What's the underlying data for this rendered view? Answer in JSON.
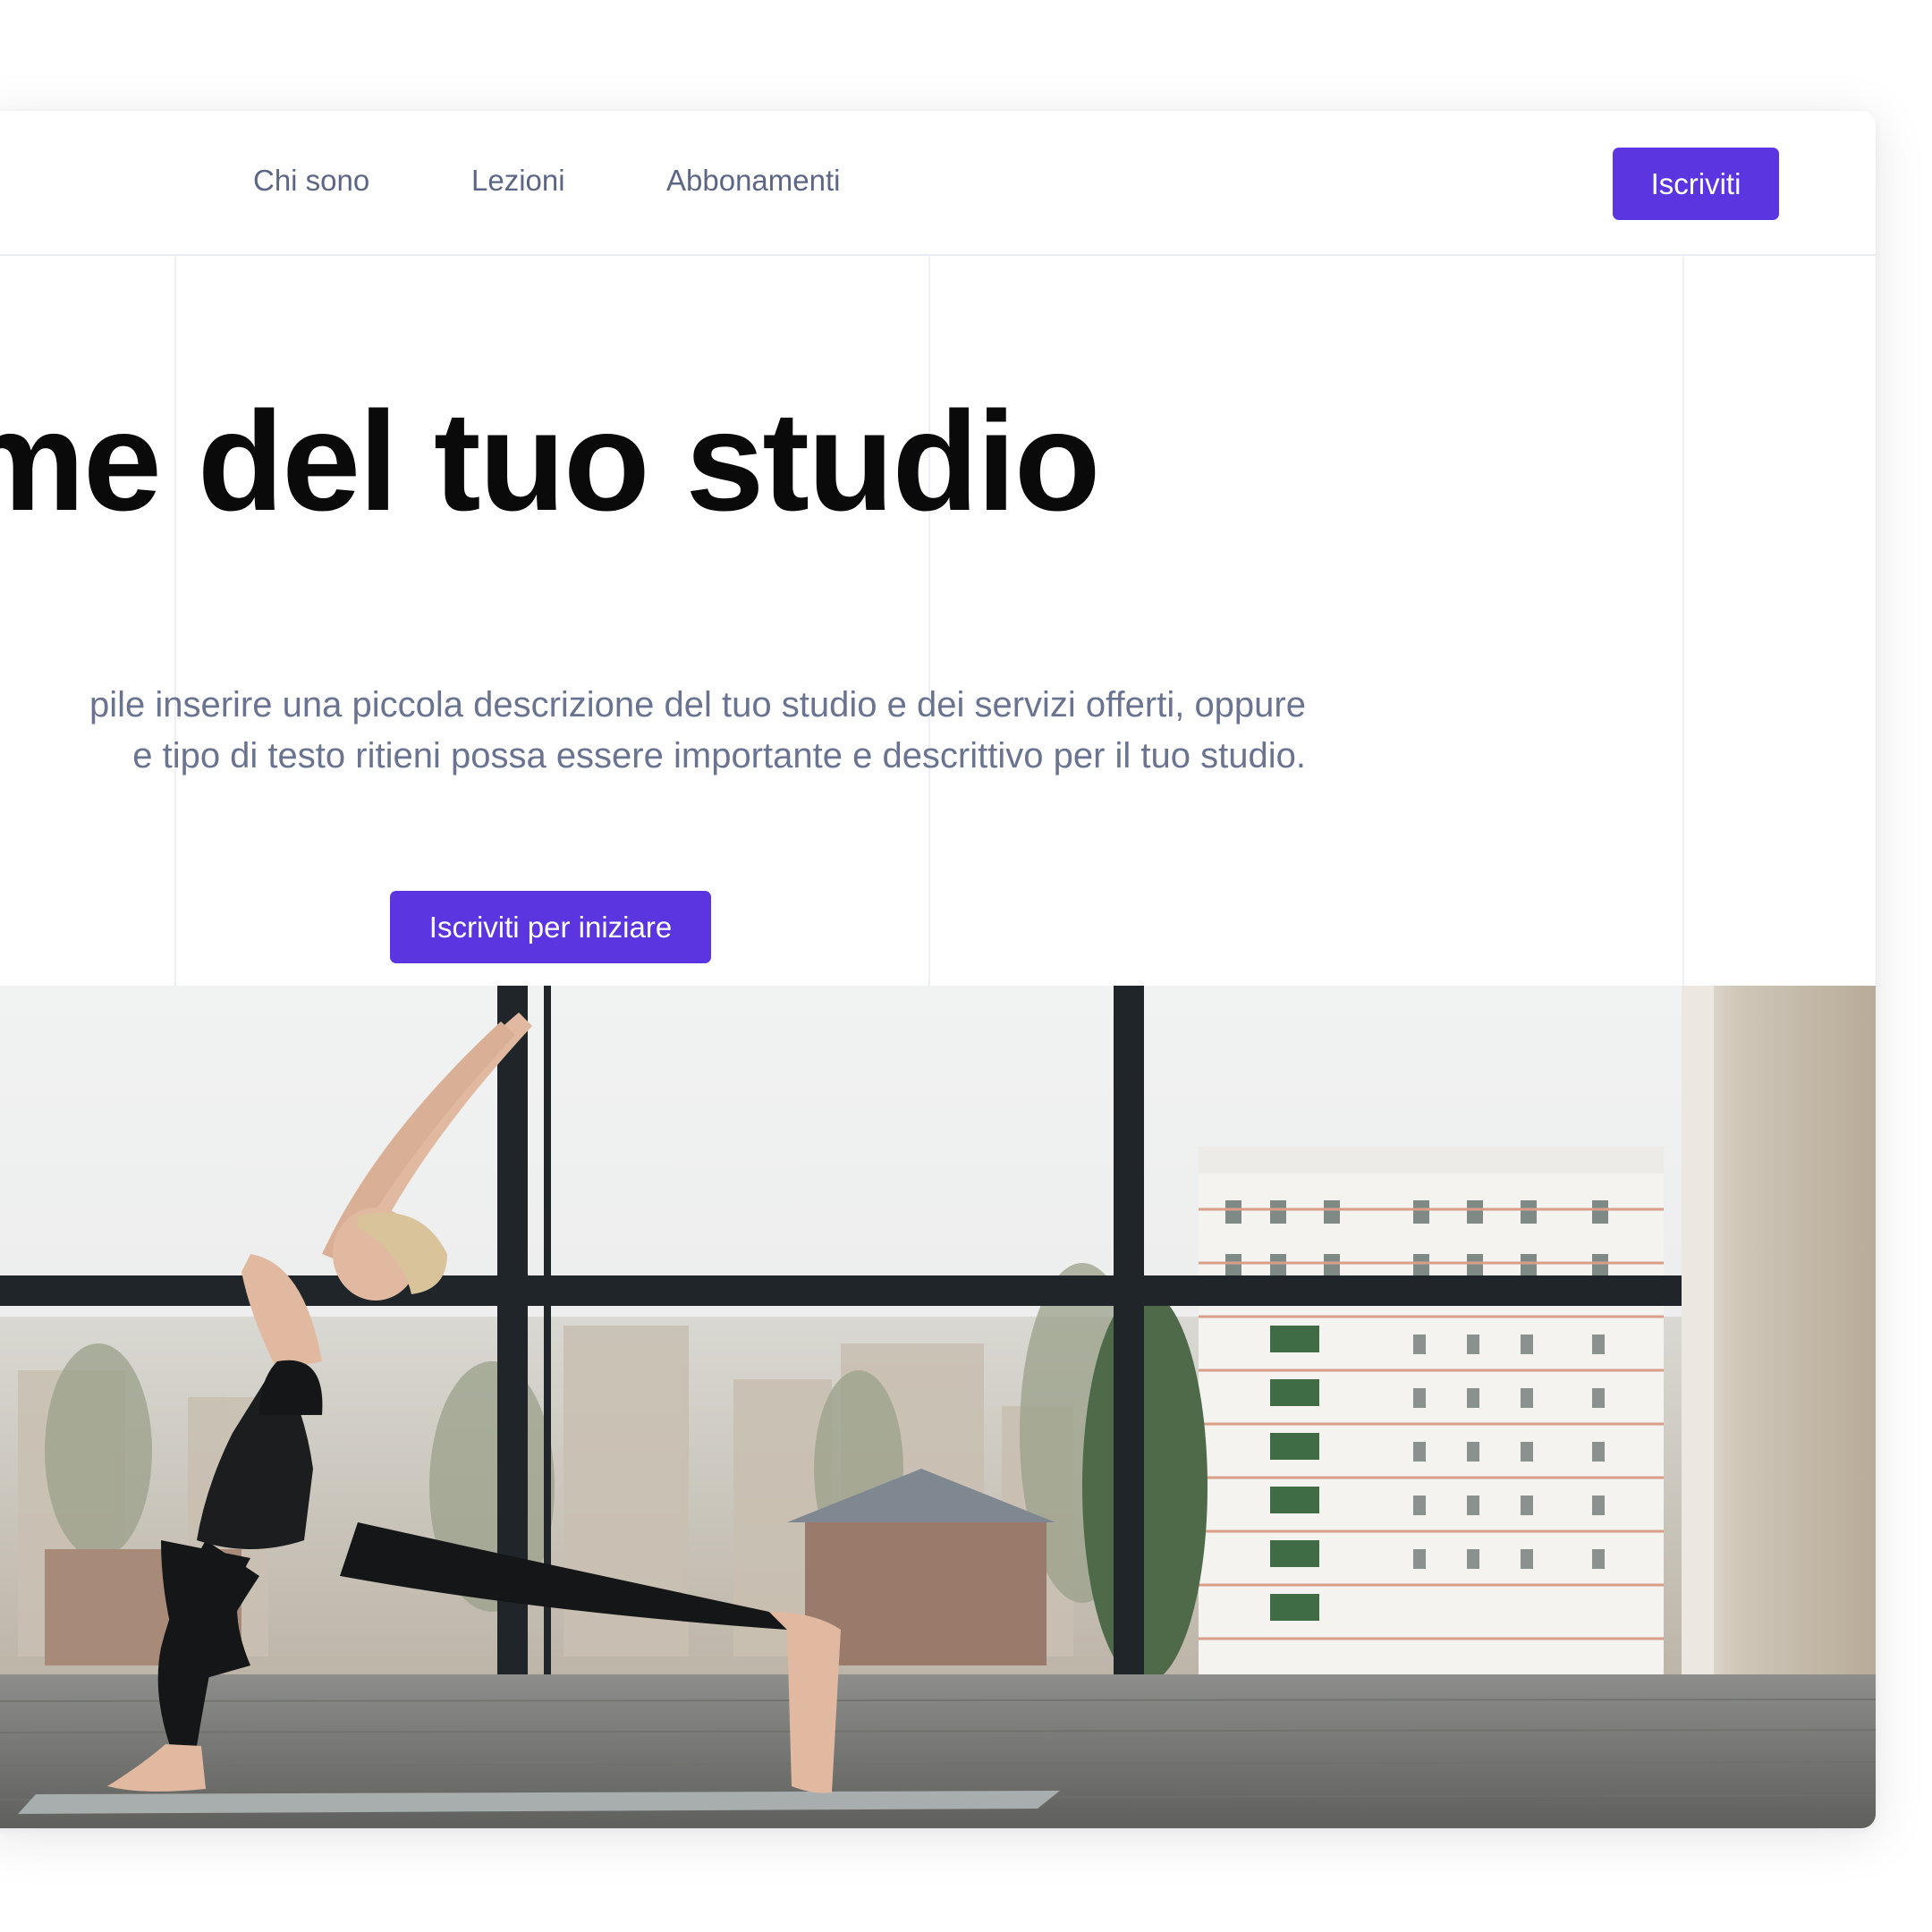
{
  "nav": {
    "links": [
      {
        "label": "Chi sono"
      },
      {
        "label": "Lezioni"
      },
      {
        "label": "Abbonamenti"
      }
    ],
    "cta_label": "Iscriviti"
  },
  "hero": {
    "title": "ome del tuo studio",
    "description_lines": [
      "pile inserire una piccola descrizione del tuo studio e dei servizi offerti, oppure",
      "e tipo di testo ritieni possa essere importante e descrittivo per il tuo studio."
    ],
    "cta_label": "Iscriviti per iniziare"
  },
  "colors": {
    "accent": "#5b35e0",
    "nav_text": "#5d6785",
    "title_text": "#0a0a0a",
    "body_text": "#6a7390"
  }
}
